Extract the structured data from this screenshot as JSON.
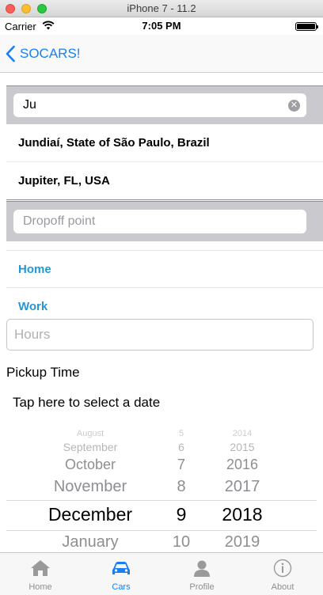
{
  "window": {
    "title": "iPhone 7 - 11.2"
  },
  "status_bar": {
    "carrier": "Carrier",
    "time": "7:05 PM"
  },
  "nav": {
    "back_label": "SOCARS!"
  },
  "pickup_search": {
    "value": "Ju",
    "clear_icon": "clear-icon"
  },
  "suggestions": [
    {
      "label": "Jundiaí, State of São Paulo, Brazil"
    },
    {
      "label": "Jupiter, FL, USA"
    }
  ],
  "dropoff_search": {
    "placeholder": "Dropoff point"
  },
  "quick_places": [
    {
      "label": "Home"
    },
    {
      "label": "Work"
    }
  ],
  "hours": {
    "placeholder": "Hours"
  },
  "pickup_time": {
    "heading": "Pickup Time",
    "prompt": "Tap here to select a date"
  },
  "date_picker": {
    "months": [
      "August",
      "September",
      "October",
      "November",
      "December",
      "January"
    ],
    "days": [
      "5",
      "6",
      "7",
      "8",
      "9",
      "10"
    ],
    "years": [
      "2014",
      "2015",
      "2016",
      "2017",
      "2018",
      "2019"
    ],
    "selected_month": "December",
    "selected_day": "9",
    "selected_year": "2018"
  },
  "tab_bar": {
    "accent": "#1a7ff0",
    "tabs": [
      {
        "label": "Home",
        "icon": "house-icon",
        "active": false
      },
      {
        "label": "Cars",
        "icon": "car-icon",
        "active": true
      },
      {
        "label": "Profile",
        "icon": "person-icon",
        "active": false
      },
      {
        "label": "About",
        "icon": "info-icon",
        "active": false
      }
    ]
  }
}
